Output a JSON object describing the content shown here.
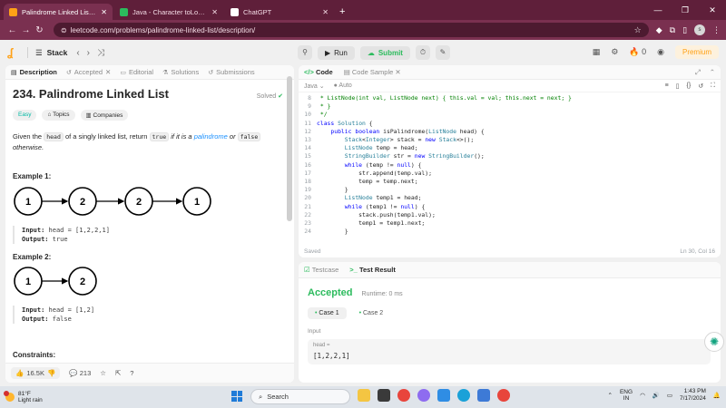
{
  "browser": {
    "tabs": [
      {
        "label": "Palindrome Linked List - LeetC",
        "active": true,
        "fav_color": "#ffa116"
      },
      {
        "label": "Java - Character toLowerCase()",
        "active": false,
        "fav_color": "#2cbb5d"
      },
      {
        "label": "ChatGPT",
        "active": false,
        "fav_color": "#ffffff"
      }
    ],
    "url": "leetcode.com/problems/palindrome-linked-list/description/",
    "profile_initial": "s"
  },
  "lcnav": {
    "stack_label": "Stack",
    "run_label": "Run",
    "submit_label": "Submit",
    "fire_count": "0",
    "premium_label": "Premium"
  },
  "left": {
    "tabs": [
      "Description",
      "Accepted",
      "Editorial",
      "Solutions",
      "Submissions"
    ],
    "title": "234. Palindrome Linked List",
    "solved_label": "Solved",
    "pills": [
      "Easy",
      "Topics",
      "Companies"
    ],
    "desc_pre": "Given the",
    "desc_code1": "head",
    "desc_mid": "of a singly linked list, return",
    "desc_code2": "true",
    "desc_ital1": "if it is a",
    "desc_link": "palindrome",
    "desc_or": "or",
    "desc_code3": "false",
    "desc_ital2": "otherwise.",
    "example1": {
      "title": "Example 1:",
      "nodes": [
        "1",
        "2",
        "2",
        "1"
      ],
      "input_label": "Input:",
      "input": "head = [1,2,2,1]",
      "output_label": "Output:",
      "output": "true"
    },
    "example2": {
      "title": "Example 2:",
      "nodes": [
        "1",
        "2"
      ],
      "input_label": "Input:",
      "input": "head = [1,2]",
      "output_label": "Output:",
      "output": "false"
    },
    "constraints_title": "Constraints:",
    "footer": {
      "likes": "16.5K",
      "comments": "213"
    }
  },
  "editor": {
    "tabs": [
      "Code",
      "Code Sample"
    ],
    "language": "Java",
    "mode": "Auto",
    "lines": [
      {
        "n": "8",
        "t": " * ListNode(int val, ListNode next) { this.val = val; this.next = next; }",
        "cls": "cm"
      },
      {
        "n": "9",
        "t": " * }",
        "cls": "cm"
      },
      {
        "n": "10",
        "t": " */",
        "cls": "cm"
      },
      {
        "n": "11",
        "t": "class Solution {",
        "cls": ""
      },
      {
        "n": "12",
        "t": "    public boolean isPalindrome(ListNode head) {",
        "cls": ""
      },
      {
        "n": "13",
        "t": "        Stack<Integer> stack = new Stack<>();",
        "cls": ""
      },
      {
        "n": "14",
        "t": "        ListNode temp = head;",
        "cls": ""
      },
      {
        "n": "15",
        "t": "        StringBuilder str = new StringBuilder();",
        "cls": ""
      },
      {
        "n": "16",
        "t": "        while (temp != null) {",
        "cls": ""
      },
      {
        "n": "17",
        "t": "            str.append(temp.val);",
        "cls": ""
      },
      {
        "n": "18",
        "t": "            temp = temp.next;",
        "cls": ""
      },
      {
        "n": "19",
        "t": "        }",
        "cls": ""
      },
      {
        "n": "20",
        "t": "        ListNode temp1 = head;",
        "cls": ""
      },
      {
        "n": "21",
        "t": "        while (temp1 != null) {",
        "cls": ""
      },
      {
        "n": "22",
        "t": "            stack.push(temp1.val);",
        "cls": ""
      },
      {
        "n": "23",
        "t": "            temp1 = temp1.next;",
        "cls": ""
      },
      {
        "n": "24",
        "t": "        }",
        "cls": ""
      }
    ],
    "status_left": "Saved",
    "status_right": "Ln 30, Col 16"
  },
  "result": {
    "tabs": [
      "Testcase",
      "Test Result"
    ],
    "verdict": "Accepted",
    "runtime": "Runtime: 0 ms",
    "cases": [
      "Case 1",
      "Case 2"
    ],
    "input_label": "Input",
    "var_name": "head =",
    "var_value": "[1,2,2,1]"
  },
  "taskbar": {
    "temp": "81°F",
    "weather": "Light rain",
    "search_placeholder": "Search",
    "lang_top": "ENG",
    "lang_bottom": "IN",
    "time": "1:43 PM",
    "date": "7/17/2024"
  }
}
